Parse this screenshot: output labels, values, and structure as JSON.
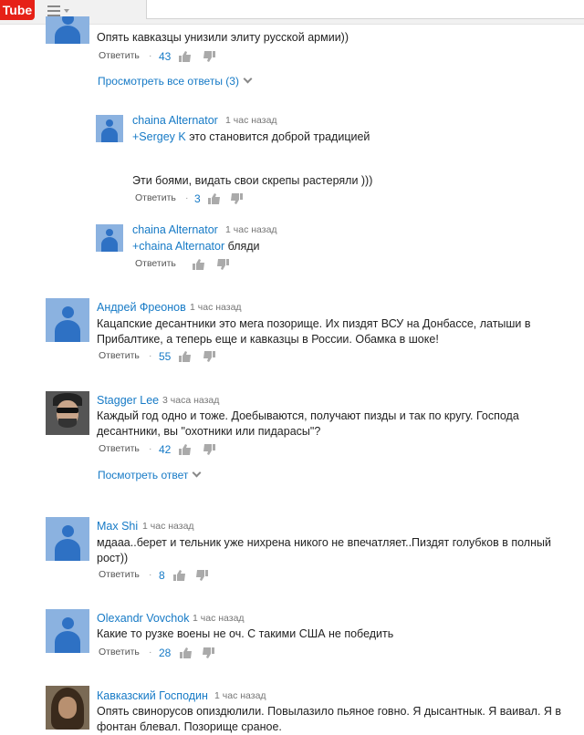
{
  "header": {
    "logo_text": "Tube"
  },
  "reply_label": "Ответить",
  "comments": [
    {
      "author": "",
      "time": "",
      "text": "Опять кавказцы унизили элиту русской армии))",
      "likes": "43"
    },
    {
      "author": "chaina Alternator",
      "time": "1 час назад",
      "mention": "+Sergey K",
      "text": " это становится доброй традицией",
      "text2": "Эти боями,  видать свои скрепы растеряли )))",
      "likes": "3"
    },
    {
      "author": "chaina Alternator",
      "time": "1 час назад",
      "mention": "+chaina Alternator",
      "text": " бляди",
      "likes": ""
    },
    {
      "author": "Андрей Фреонов",
      "time": "1 час назад",
      "text": "Кацапские десантники это мега позорище. Их пиздят ВСУ на Донбассе, латыши в Прибалтике, а теперь еще и кавказцы в России. Обамка в шоке!",
      "likes": "55"
    },
    {
      "author": "Stagger Lee",
      "time": "3 часа назад",
      "text": "Каждый год одно и тоже. Доебываются, получают пизды и так по кругу. Господа десантники, вы \"охотники или пидарасы\"?",
      "likes": "42"
    },
    {
      "author": "Max Shi",
      "time": "1 час назад",
      "text": "мдааа..берет и тельник уже нихрена никого не впечатляет..Пиздят голубков в полный рост))",
      "likes": "8"
    },
    {
      "author": "Olexandr Vovchok",
      "time": "1 час назад",
      "text": "Какие то рузке воены не оч. С такими США не победить",
      "likes": "28"
    },
    {
      "author": "Кавказский Господин",
      "time": "1 час назад",
      "text": "Опять свинорусов опиздюлили. Повылазило пьяное говно. Я дысантнык. Я ваивал. Я в фонтан блевал. Позорище сраное.",
      "likes": ""
    }
  ],
  "view_all_replies": "Просмотреть все ответы (3)",
  "view_reply": "Посмотреть ответ"
}
